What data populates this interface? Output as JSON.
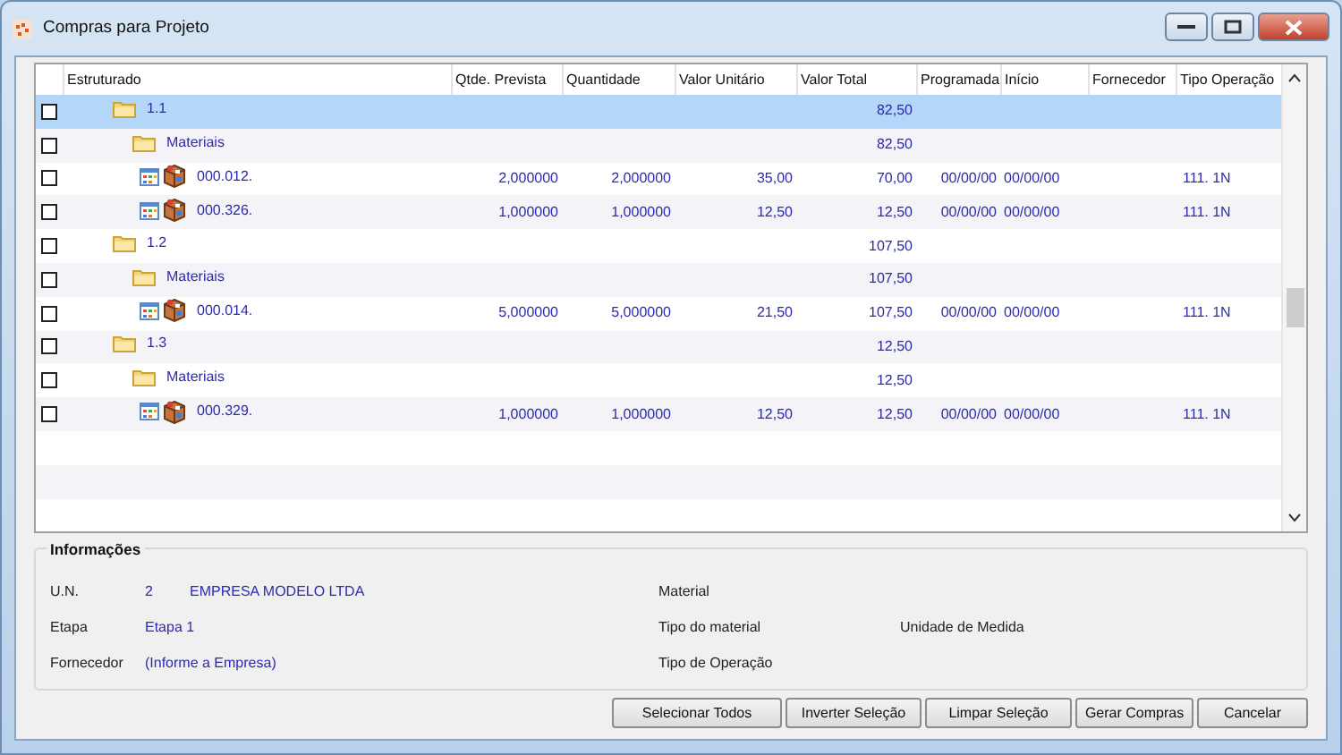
{
  "window": {
    "title": "Compras para Projeto"
  },
  "table": {
    "columns": [
      "Estruturado",
      "Qtde. Prevista",
      "Quantidade",
      "Valor Unitário",
      "Valor Total",
      "Programada",
      "Início",
      "Fornecedor",
      "Tipo Operação"
    ],
    "rows": [
      {
        "kind": "group",
        "label": "1.1",
        "checked": false,
        "selected": true,
        "total": "82,50",
        "children": [
          {
            "kind": "group",
            "label": "Materiais",
            "checked": false,
            "selected": false,
            "total": "82,50",
            "children": [
              {
                "kind": "item",
                "label": "000.012.",
                "checked": false,
                "selected": false,
                "prevista": "2,000000",
                "quantidade": "2,000000",
                "unitario": "35,00",
                "total": "70,00",
                "programada": "00/00/00",
                "inicio": "00/00/00",
                "tipo": "111. 1N"
              },
              {
                "kind": "item",
                "label": "000.326.",
                "checked": false,
                "selected": false,
                "prevista": "1,000000",
                "quantidade": "1,000000",
                "unitario": "12,50",
                "total": "12,50",
                "programada": "00/00/00",
                "inicio": "00/00/00",
                "tipo": "111. 1N"
              }
            ]
          }
        ]
      },
      {
        "kind": "group",
        "label": "1.2",
        "checked": false,
        "selected": false,
        "total": "107,50",
        "children": [
          {
            "kind": "group",
            "label": "Materiais",
            "checked": false,
            "selected": false,
            "total": "107,50",
            "children": [
              {
                "kind": "item",
                "label": "000.014.",
                "checked": false,
                "selected": false,
                "prevista": "5,000000",
                "quantidade": "5,000000",
                "unitario": "21,50",
                "total": "107,50",
                "programada": "00/00/00",
                "inicio": "00/00/00",
                "tipo": "111. 1N"
              }
            ]
          }
        ]
      },
      {
        "kind": "group",
        "label": "1.3",
        "checked": false,
        "selected": false,
        "total": "12,50",
        "children": [
          {
            "kind": "group",
            "label": "Materiais",
            "checked": false,
            "selected": false,
            "total": "12,50",
            "children": [
              {
                "kind": "item",
                "label": "000.329.",
                "checked": false,
                "selected": false,
                "prevista": "1,000000",
                "quantidade": "1,000000",
                "unitario": "12,50",
                "total": "12,50",
                "programada": "00/00/00",
                "inicio": "00/00/00",
                "tipo": "111. 1N"
              }
            ]
          }
        ]
      }
    ]
  },
  "info": {
    "title": "Informações",
    "left": [
      {
        "label": "U.N.",
        "code": "2",
        "value": "EMPRESA MODELO LTDA"
      },
      {
        "label": "Etapa",
        "value": "Etapa 1"
      },
      {
        "label": "Fornecedor",
        "value": "(Informe a Empresa)"
      }
    ],
    "right": [
      {
        "label": "Material"
      },
      {
        "label": "Tipo do material",
        "extra": "Unidade de Medida"
      },
      {
        "label": "Tipo de Operação"
      }
    ]
  },
  "buttons": [
    "Selecionar Todos",
    "Inverter Seleção",
    "Limpar Seleção",
    "Gerar Compras",
    "Cancelar"
  ]
}
